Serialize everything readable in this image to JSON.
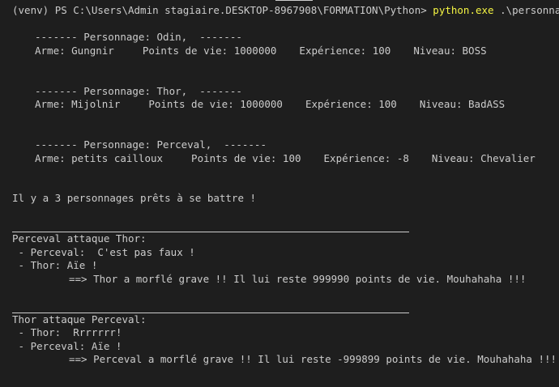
{
  "prompt": {
    "venv": "(venv)",
    "ps": "PS C:\\Users\\Admin stagiaire.DESKTOP-8967908\\FORMATION\\Python>",
    "command": "python.exe",
    "args": ".\\personnage.py"
  },
  "characters": [
    {
      "header": "------- Personnage: Odin,  -------",
      "arme": "Arme: Gungnir",
      "pv": "Points de vie: 1000000",
      "xp": "Expérience: 100",
      "niveau": "Niveau: BOSS"
    },
    {
      "header": "------- Personnage: Thor,  -------",
      "arme": "Arme: Mijolnir",
      "pv": "Points de vie: 1000000",
      "xp": "Expérience: 100",
      "niveau": "Niveau: BadASS"
    },
    {
      "header": "------- Personnage: Perceval,  -------",
      "arme": "Arme: petits cailloux",
      "pv": "Points de vie: 100",
      "xp": "Expérience: -8",
      "niveau": "Niveau: Chevalier"
    }
  ],
  "summary": "Il y a 3 personnages prêts à se battre !",
  "fights": [
    {
      "title": "Perceval attaque Thor:",
      "line1": " - Perceval:  C'est pas faux !",
      "line2": " - Thor: Aïe !",
      "result": "==> Thor a morflé grave !! Il lui reste 999990 points de vie. Mouhahaha !!!"
    },
    {
      "title": "Thor attaque Perceval:",
      "line1": " - Thor:  Rrrrrrr!",
      "line2": " - Perceval: Aïe !",
      "result": "==> Perceval a morflé grave !! Il lui reste -999899 points de vie. Mouhahaha !!!"
    }
  ],
  "colors": {
    "background": "#1e1e1e",
    "text": "#cccccc",
    "command": "#f5f543"
  }
}
